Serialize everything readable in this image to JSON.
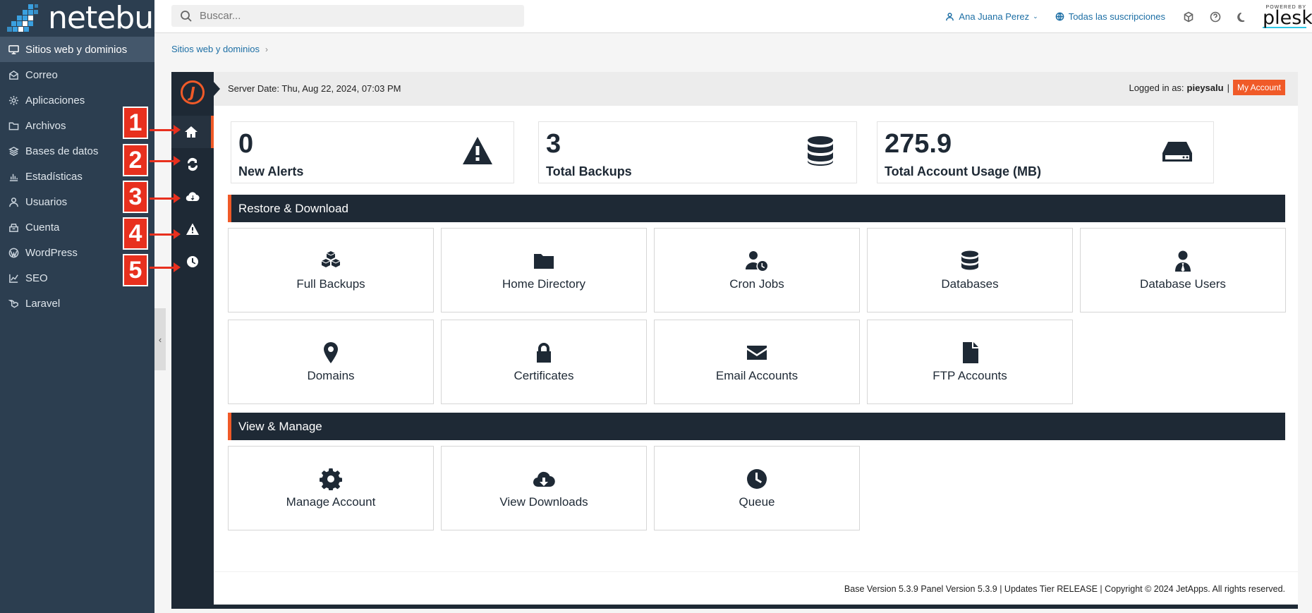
{
  "sidebar": {
    "logo": "netebu",
    "items": [
      {
        "label": "Sitios web y dominios",
        "icon": "monitor-icon",
        "active": true
      },
      {
        "label": "Correo",
        "icon": "mail-icon"
      },
      {
        "label": "Aplicaciones",
        "icon": "gear-icon"
      },
      {
        "label": "Archivos",
        "icon": "folder-icon"
      },
      {
        "label": "Bases de datos",
        "icon": "database-icon"
      },
      {
        "label": "Estadísticas",
        "icon": "bar-chart-icon"
      },
      {
        "label": "Usuarios",
        "icon": "user-icon"
      },
      {
        "label": "Cuenta",
        "icon": "account-icon"
      },
      {
        "label": "WordPress",
        "icon": "wordpress-icon"
      },
      {
        "label": "SEO",
        "icon": "seo-icon"
      },
      {
        "label": "Laravel",
        "icon": "laravel-icon"
      }
    ]
  },
  "topbar": {
    "search_placeholder": "Buscar...",
    "user_name": "Ana Juana Perez",
    "subscriptions": "Todas las suscripciones",
    "powered_by": "POWERED BY",
    "brand": "plesk"
  },
  "breadcrumb": {
    "item": "Sitios web y dominios",
    "separator": "›"
  },
  "jetbackup": {
    "server_date": "Server Date: Thu, Aug 22, 2024, 07:03 PM",
    "logged_in_label": "Logged in as:",
    "logged_in_user": "pieysalu",
    "pipe": "|",
    "my_account": "My Account",
    "stats": [
      {
        "value": "0",
        "label": "New Alerts",
        "icon": "warning-icon"
      },
      {
        "value": "3",
        "label": "Total Backups",
        "icon": "database-icon"
      },
      {
        "value": "275.9",
        "label": "Total Account Usage (MB)",
        "icon": "hard-drive-icon"
      }
    ],
    "sections": {
      "restore": "Restore & Download",
      "manage": "View & Manage"
    },
    "restore_tiles": [
      {
        "label": "Full Backups",
        "icon": "cubes-icon"
      },
      {
        "label": "Home Directory",
        "icon": "folder-icon"
      },
      {
        "label": "Cron Jobs",
        "icon": "user-clock-icon"
      },
      {
        "label": "Databases",
        "icon": "database-icon"
      },
      {
        "label": "Database Users",
        "icon": "user-tie-icon"
      },
      {
        "label": "Domains",
        "icon": "map-marker-icon"
      },
      {
        "label": "Certificates",
        "icon": "lock-icon"
      },
      {
        "label": "Email Accounts",
        "icon": "envelope-icon"
      },
      {
        "label": "FTP Accounts",
        "icon": "file-icon"
      }
    ],
    "manage_tiles": [
      {
        "label": "Manage Account",
        "icon": "gear-icon"
      },
      {
        "label": "View Downloads",
        "icon": "cloud-download-icon"
      },
      {
        "label": "Queue",
        "icon": "clock-icon"
      }
    ],
    "footer": "Base Version 5.3.9 Panel Version 5.3.9 | Updates Tier RELEASE | Copyright © 2024 JetApps. All rights reserved."
  },
  "callouts": [
    "1",
    "2",
    "3",
    "4",
    "5"
  ],
  "colors": {
    "accent": "#f05a28",
    "dark": "#1e2935",
    "sidebar": "#2c3e50",
    "link": "#1d6fa5",
    "callout": "#e8301e"
  }
}
